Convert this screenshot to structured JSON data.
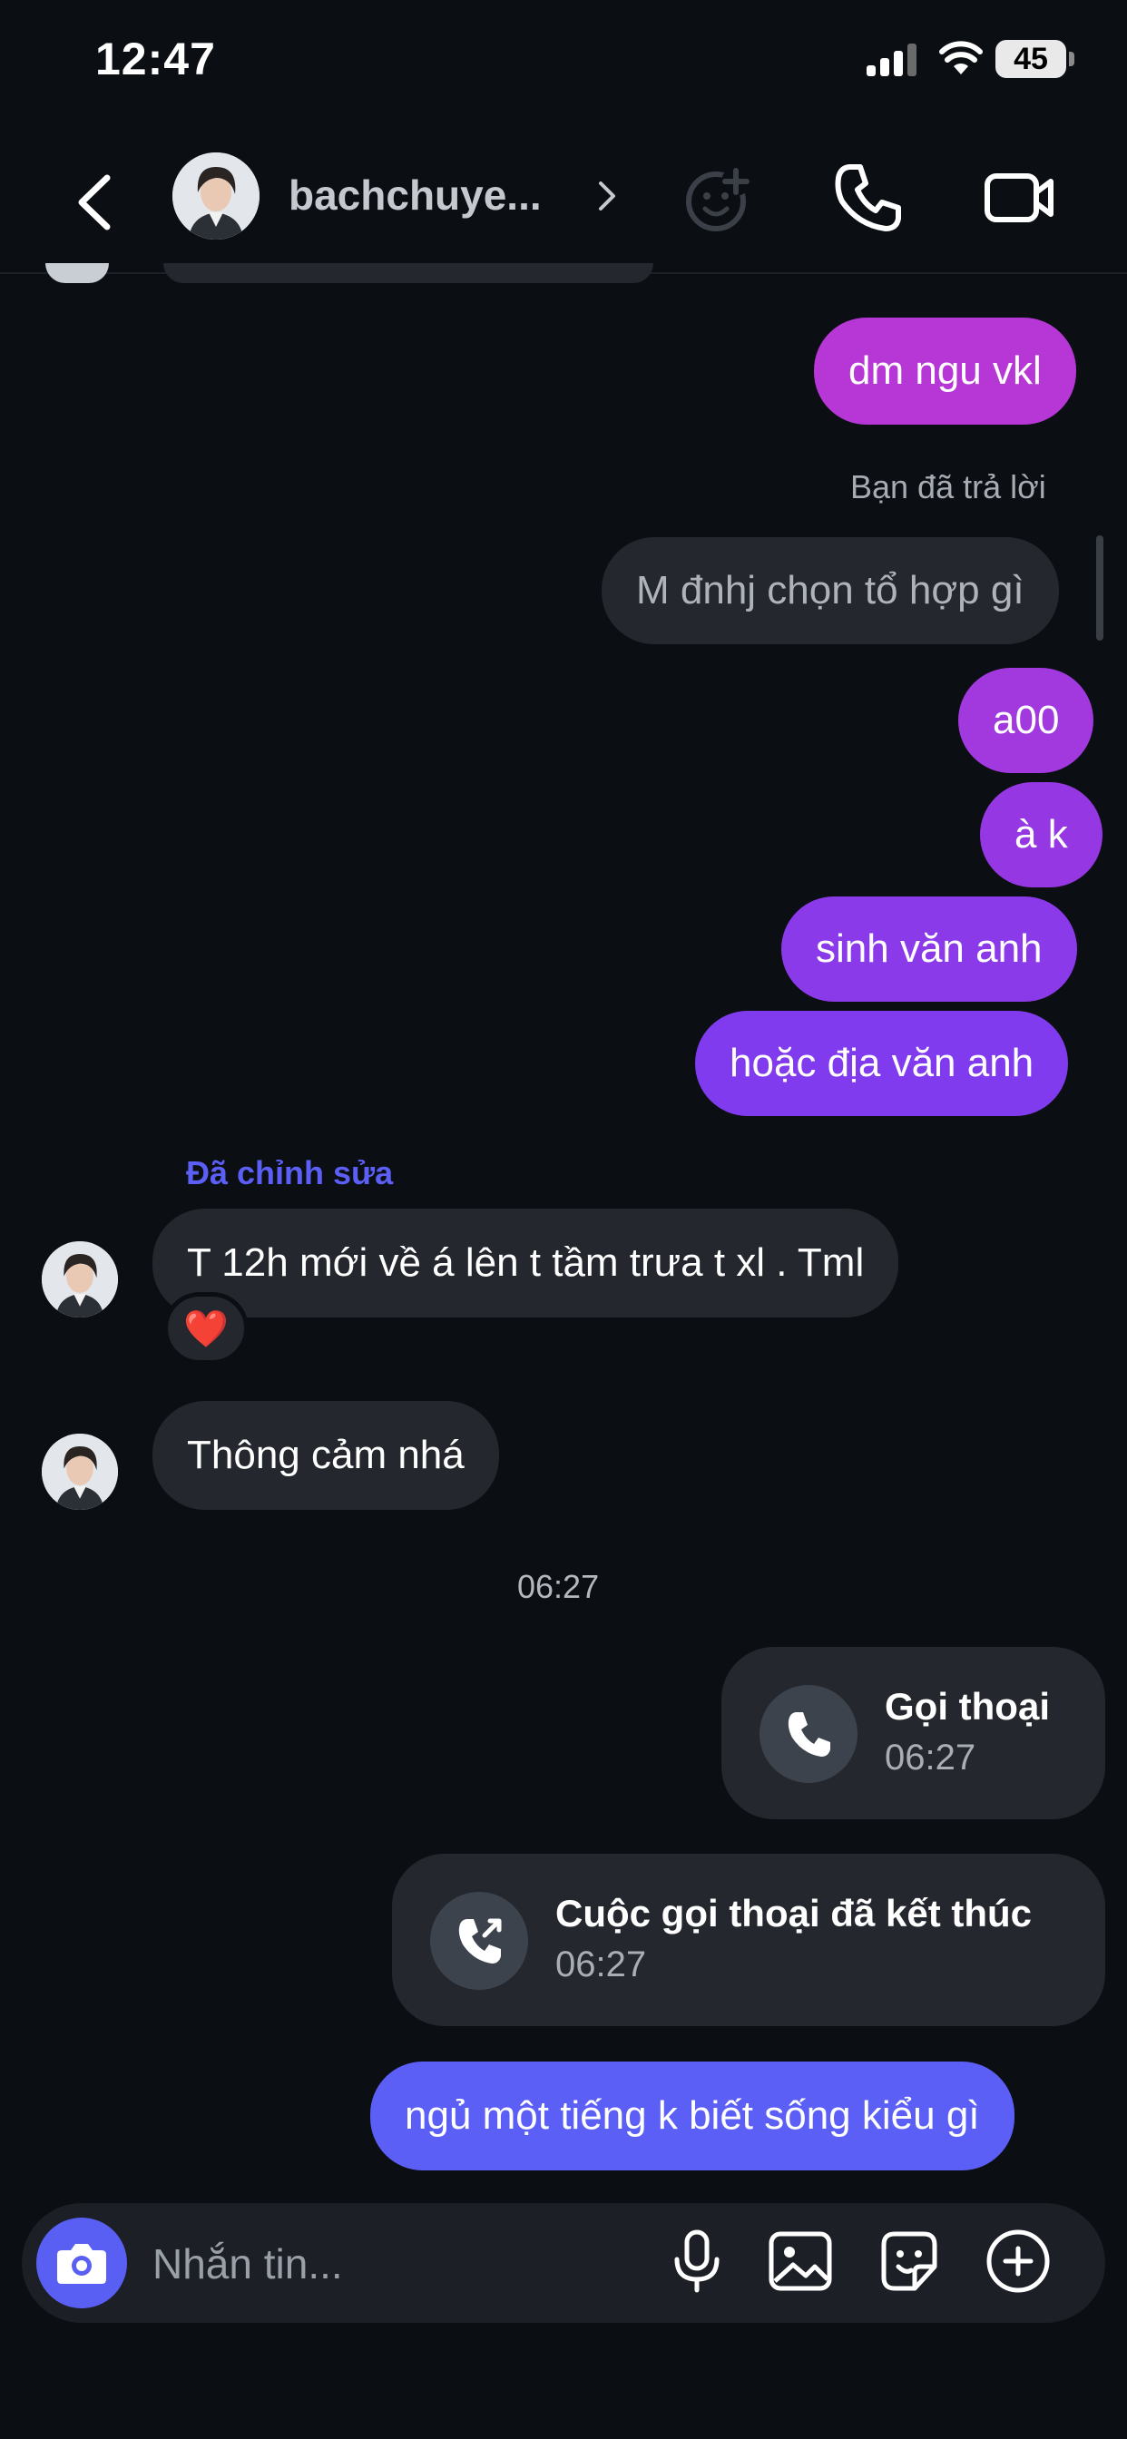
{
  "status": {
    "time": "12:47",
    "battery": "45"
  },
  "header": {
    "contact_name": "bachchuye..."
  },
  "messages": {
    "m1": "dm ngu vkl",
    "reply_label": "Bạn đã trả lời",
    "replied_quote": "M đnhj chọn tổ hợp gì",
    "m2": "a00",
    "m3": "à k",
    "m4": "sinh văn anh",
    "m5": "hoặc địa văn anh",
    "edited_label": "Đã chỉnh sửa",
    "m6": "T 12h mới về á lên t tầm trưa t xl . Tml",
    "reaction": "❤️",
    "m7": "Thông cảm nhá",
    "time_separator": "06:27",
    "call1_title": "Gọi thoại",
    "call1_time": "06:27",
    "call2_title": "Cuộc gọi thoại đã kết thúc",
    "call2_time": "06:27",
    "m8": "ngủ một tiếng k biết sống kiểu gì"
  },
  "composer": {
    "placeholder": "Nhắn tin..."
  },
  "colors": {
    "accent": "#5a5ff4",
    "outgoing_top": "#b637d6",
    "outgoing_bottom": "#5b5ff6",
    "incoming": "#24282e"
  }
}
